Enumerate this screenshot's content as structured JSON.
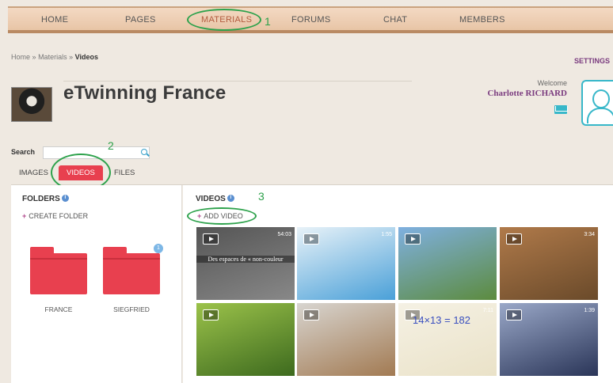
{
  "nav": {
    "items": [
      "HOME",
      "PAGES",
      "MATERIALS",
      "FORUMS",
      "CHAT",
      "MEMBERS"
    ],
    "active": "MATERIALS"
  },
  "annotations": [
    "1",
    "2",
    "3"
  ],
  "breadcrumb": {
    "home": "Home",
    "sep": "»",
    "materials": "Materials",
    "current": "Videos"
  },
  "settings_label": "SETTINGS",
  "group": {
    "title": "eTwinning France"
  },
  "user": {
    "welcome": "Welcome",
    "name": "Charlotte RICHARD"
  },
  "search": {
    "label": "Search",
    "value": ""
  },
  "tabs": [
    "IMAGES",
    "VIDEOS",
    "FILES"
  ],
  "active_tab": "VIDEOS",
  "folders_panel": {
    "title": "FOLDERS",
    "info": "i",
    "create_label": "CREATE FOLDER",
    "folders": [
      {
        "name": "FRANCE",
        "badge": ""
      },
      {
        "name": "SIEGFRIED",
        "badge": "1"
      }
    ]
  },
  "videos_panel": {
    "title": "VIDEOS",
    "info": "i",
    "add_label": "ADD VIDEO",
    "videos": [
      {
        "duration": "54:03",
        "caption": "Des espaces de « non-couleur",
        "overlay": "",
        "palette": [
          "#555",
          "#888"
        ]
      },
      {
        "duration": "1:55",
        "caption": "",
        "overlay": "",
        "palette": [
          "#e8f2f8",
          "#4aa0d8"
        ]
      },
      {
        "duration": "",
        "caption": "",
        "overlay": "",
        "palette": [
          "#7fb0e0",
          "#5c8b3e"
        ]
      },
      {
        "duration": "3:34",
        "caption": "",
        "overlay": "",
        "palette": [
          "#b07a4a",
          "#6a4a2a"
        ]
      },
      {
        "duration": "",
        "caption": "",
        "overlay": "",
        "palette": [
          "#9bc24a",
          "#3d6a1e"
        ]
      },
      {
        "duration": "",
        "caption": "",
        "overlay": "",
        "palette": [
          "#d8d5d0",
          "#a27a52"
        ]
      },
      {
        "duration": "7:11",
        "caption": "",
        "overlay": "14×13 = 182",
        "palette": [
          "#f5f1e4",
          "#eae2c8"
        ]
      },
      {
        "duration": "1:39",
        "caption": "",
        "overlay": "",
        "palette": [
          "#9aa8c8",
          "#2a3558"
        ]
      }
    ]
  }
}
